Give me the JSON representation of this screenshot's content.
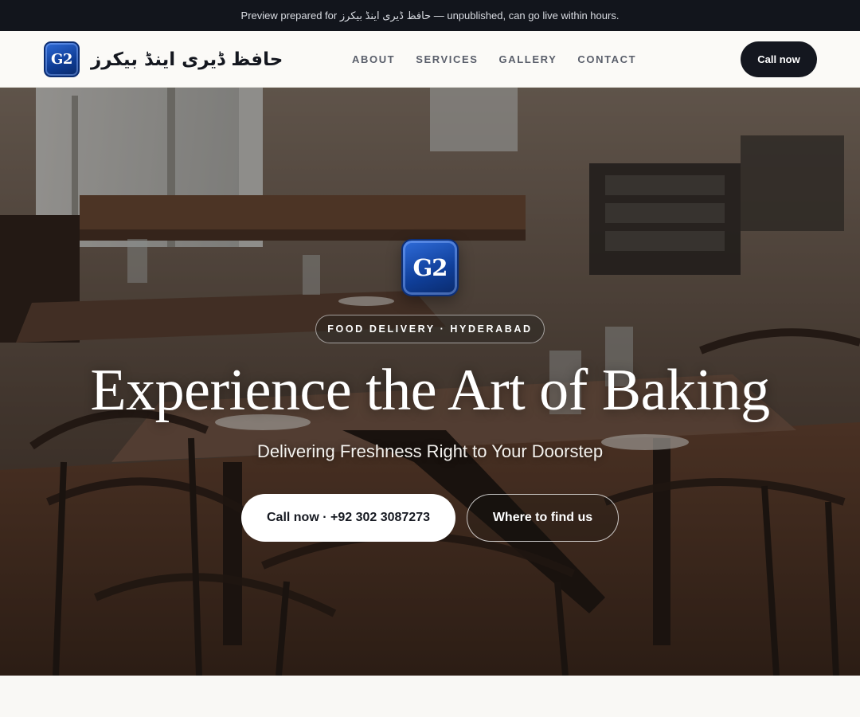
{
  "preview_banner": {
    "text": "Preview prepared for حافظ ڈیری اینڈ بیکرز — unpublished, can go live within hours."
  },
  "header": {
    "logo_text": "G2",
    "brand_name": "حافظ ڈیری اینڈ بیکرز",
    "nav": [
      {
        "label": "ABOUT"
      },
      {
        "label": "SERVICES"
      },
      {
        "label": "GALLERY"
      },
      {
        "label": "CONTACT"
      }
    ],
    "call_button": "Call now"
  },
  "hero": {
    "logo_text": "G2",
    "tag": "FOOD DELIVERY · HYDERABAD",
    "title": "Experience the Art of Baking",
    "subtitle": "Delivering Freshness Right to Your Doorstep",
    "primary_button": "Call now · +92 302 3087273",
    "secondary_button": "Where to find us",
    "background_description_icon": "restaurant-interior-photo"
  },
  "colors": {
    "dark": "#14171f",
    "banner_bg": "#12151c",
    "logo_blue": "#0f3e98",
    "page_bg": "#f9f8f5"
  }
}
